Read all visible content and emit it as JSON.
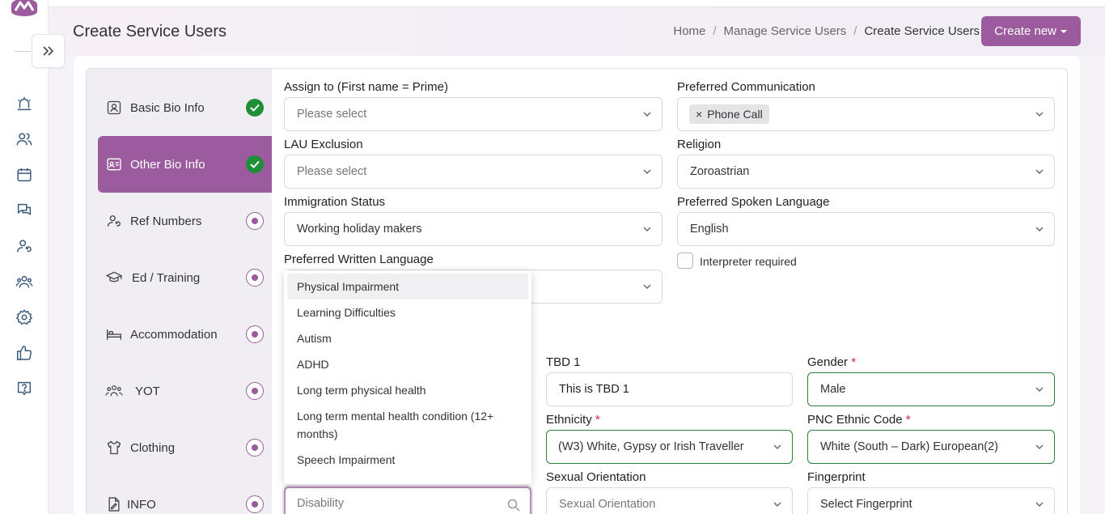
{
  "app": {
    "title": "Create Service Users",
    "breadcrumb": [
      "Home",
      "Manage Service Users",
      "Create Service Users"
    ],
    "breadcrumb_sep": "/",
    "create_button": "Create new",
    "brand_color": "#9b5b9d"
  },
  "rail": {
    "icons": [
      "alarm-icon",
      "users-icon",
      "calendar-icon",
      "chat-icon",
      "user-refresh-icon",
      "team-icon",
      "settings-icon",
      "thumbs-up-icon",
      "help-icon"
    ]
  },
  "steps": [
    {
      "label": "Basic Bio Info",
      "icon": "id-badge-icon",
      "state": "done"
    },
    {
      "label": "Other Bio Info",
      "icon": "id-card-icon",
      "state": "done"
    },
    {
      "label": "Ref Numbers",
      "icon": "user-refresh-icon",
      "state": "pending"
    },
    {
      "label": "Ed / Training",
      "icon": "graduation-cap-icon",
      "state": "pending"
    },
    {
      "label": "Accommodation",
      "icon": "bed-icon",
      "state": "pending"
    },
    {
      "label": "YOT",
      "icon": "group-icon",
      "state": "pending"
    },
    {
      "label": "Clothing",
      "icon": "shirt-icon",
      "state": "pending"
    },
    {
      "label": "INFO",
      "icon": "document-icon",
      "state": "pending"
    }
  ],
  "form": {
    "assign_to": {
      "label": "Assign to (First name = Prime)",
      "value": "Please select"
    },
    "preferred_communication": {
      "label": "Preferred Communication",
      "chip": "Phone Call",
      "chip_close": "×"
    },
    "lau_exclusion": {
      "label": "LAU Exclusion",
      "value": "Please select"
    },
    "religion": {
      "label": "Religion",
      "value": "Zoroastrian"
    },
    "immigration_status": {
      "label": "Immigration Status",
      "value": "Working holiday makers"
    },
    "preferred_spoken_language": {
      "label": "Preferred Spoken Language",
      "value": "English"
    },
    "preferred_written_language": {
      "label": "Preferred Written Language"
    },
    "interpreter": {
      "label": "Interpreter required",
      "checked": false
    },
    "tbd1": {
      "label": "TBD 1",
      "value": "This is TBD 1"
    },
    "gender": {
      "label": "Gender",
      "required": "*",
      "value": "Male"
    },
    "ethnicity": {
      "label": "Ethnicity",
      "required": "*",
      "value": "(W3) White, Gypsy or Irish Traveller"
    },
    "pnc_ethnic_code": {
      "label": "PNC Ethnic Code",
      "required": "*",
      "value": "White (South – Dark) European(2)"
    },
    "sexual_orientation": {
      "label": "Sexual Orientation",
      "placeholder": "Sexual Orientation"
    },
    "fingerprint": {
      "label": "Fingerprint",
      "value": "Select Fingerprint"
    },
    "disability": {
      "placeholder": "Disability"
    }
  },
  "disability_dropdown": {
    "options": [
      "Physical Impairment",
      "Learning Difficulties",
      "Autism",
      "ADHD",
      "Long term physical health",
      "Long term mental health condition (12+ months)",
      "Speech Impairment"
    ],
    "highlighted_index": 0
  }
}
